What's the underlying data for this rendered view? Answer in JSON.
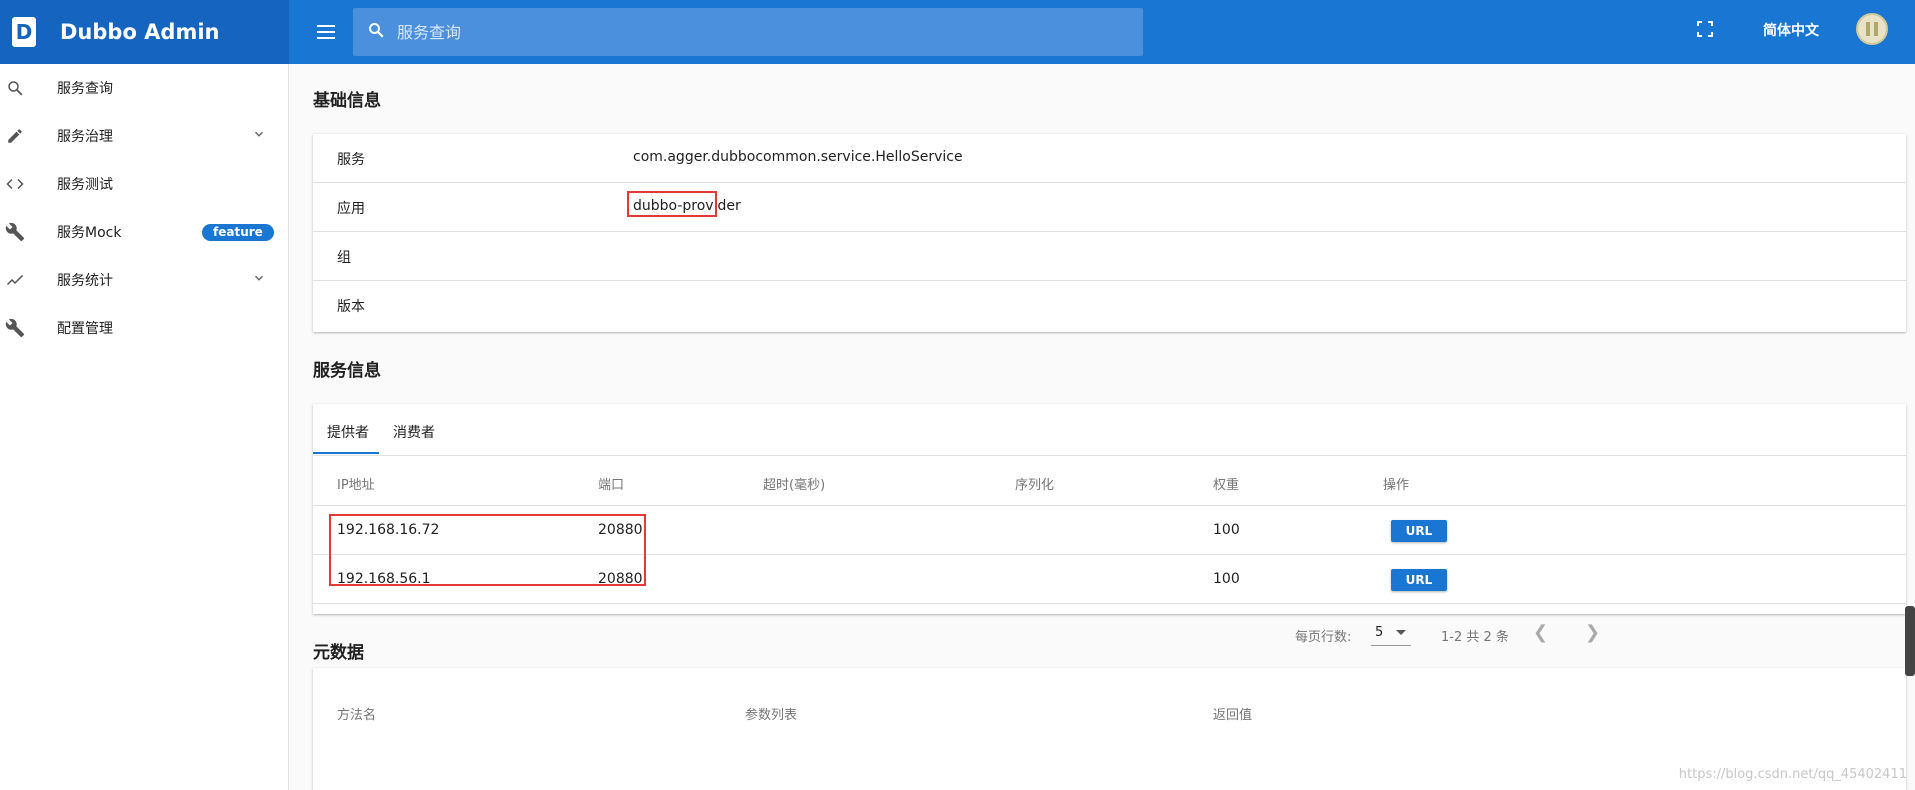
{
  "app": {
    "title": "Dubbo Admin",
    "logo_letter": "D"
  },
  "sidebar": {
    "items": [
      {
        "label": "服务查询",
        "icon": "search-icon"
      },
      {
        "label": "服务治理",
        "icon": "pencil-icon",
        "expandable": true
      },
      {
        "label": "服务测试",
        "icon": "code-icon"
      },
      {
        "label": "服务Mock",
        "icon": "wrench-icon",
        "badge": "feature"
      },
      {
        "label": "服务统计",
        "icon": "chart-icon",
        "expandable": true
      },
      {
        "label": "配置管理",
        "icon": "wrench-icon"
      }
    ]
  },
  "topbar": {
    "search_placeholder": "服务查询",
    "language": "简体中文"
  },
  "basic_info": {
    "title": "基础信息",
    "rows": [
      {
        "key": "服务",
        "value": "com.agger.dubbocommon.service.HelloService"
      },
      {
        "key": "应用",
        "value": "dubbo-provider"
      },
      {
        "key": "组",
        "value": ""
      },
      {
        "key": "版本",
        "value": ""
      }
    ]
  },
  "service_info": {
    "title": "服务信息",
    "tabs": [
      "提供者",
      "消费者"
    ],
    "columns": [
      "IP地址",
      "端口",
      "超时(毫秒)",
      "序列化",
      "权重",
      "操作"
    ],
    "rows": [
      {
        "ip": "192.168.16.72",
        "port": "20880",
        "timeout": "",
        "serialization": "",
        "weight": "100",
        "action": "URL"
      },
      {
        "ip": "192.168.56.1",
        "port": "20880",
        "timeout": "",
        "serialization": "",
        "weight": "100",
        "action": "URL"
      }
    ],
    "pagination": {
      "rows_per_page_label": "每页行数:",
      "rows_per_page": "5",
      "range": "1-2 共 2 条"
    }
  },
  "metadata": {
    "title": "元数据",
    "columns": [
      "方法名",
      "参数列表",
      "返回值"
    ]
  },
  "watermark": "https://blog.csdn.net/qq_45402411",
  "colors": {
    "primary": "#1976d2",
    "brand_bar": "#1565c0",
    "highlight": "#e53935"
  }
}
